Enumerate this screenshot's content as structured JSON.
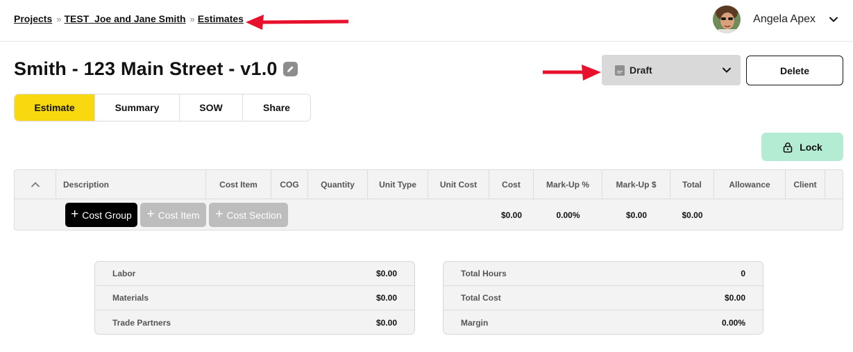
{
  "breadcrumb": [
    {
      "label": "Projects"
    },
    {
      "label": "TEST_Joe and Jane Smith"
    },
    {
      "label": "Estimates"
    }
  ],
  "breadcrumb_separator": "»",
  "user": {
    "name": "Angela Apex"
  },
  "page_title": "Smith - 123 Main Street - v1.0",
  "status": {
    "selected": "Draft"
  },
  "actions": {
    "delete_label": "Delete",
    "lock_label": "Lock"
  },
  "tabs": [
    {
      "label": "Estimate",
      "active": true
    },
    {
      "label": "Summary",
      "active": false
    },
    {
      "label": "SOW",
      "active": false
    },
    {
      "label": "Share",
      "active": false
    }
  ],
  "table": {
    "columns": [
      "Description",
      "Cost Item",
      "COG",
      "Quantity",
      "Unit Type",
      "Unit Cost",
      "Cost",
      "Mark-Up %",
      "Mark-Up $",
      "Total",
      "Allowance",
      "Client"
    ],
    "add_buttons": [
      "Cost Group",
      "Cost Item",
      "Cost Section"
    ],
    "totals": {
      "cost": "$0.00",
      "markup_pct": "0.00%",
      "markup_amt": "$0.00",
      "total": "$0.00"
    }
  },
  "summary_left": [
    {
      "label": "Labor",
      "value": "$0.00"
    },
    {
      "label": "Materials",
      "value": "$0.00"
    },
    {
      "label": "Trade Partners",
      "value": "$0.00"
    }
  ],
  "summary_right": [
    {
      "label": "Total Hours",
      "value": "0"
    },
    {
      "label": "Total Cost",
      "value": "$0.00"
    },
    {
      "label": "Margin",
      "value": "0.00%"
    }
  ],
  "colors": {
    "accent_yellow": "#f8d80f",
    "lock_green": "#b3ecd3",
    "annotation_red": "#e8112d"
  }
}
